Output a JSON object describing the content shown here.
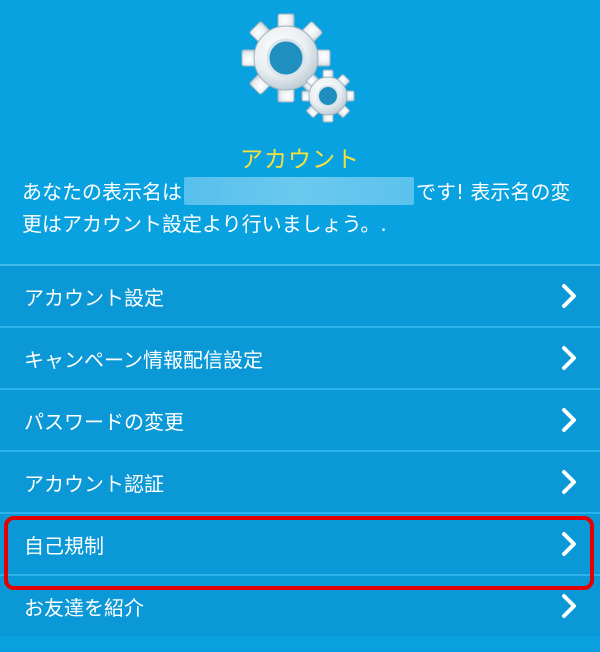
{
  "header": {
    "title": "アカウント",
    "message_prefix": "あなたの表示名は",
    "message_suffix": "です! 表示名の変更はアカウント設定より行いましょう。."
  },
  "menu": {
    "items": [
      {
        "label": "アカウント設定"
      },
      {
        "label": "キャンペーン情報配信設定"
      },
      {
        "label": "パスワードの変更"
      },
      {
        "label": "アカウント認証"
      },
      {
        "label": "自己規制"
      },
      {
        "label": "お友達を紹介"
      }
    ]
  },
  "colors": {
    "background": "#0a9fde",
    "title": "#f6e13d",
    "highlight": "#e40000"
  },
  "icons": {
    "header": "gears-icon",
    "menu_arrow": "chevron-right-icon"
  }
}
